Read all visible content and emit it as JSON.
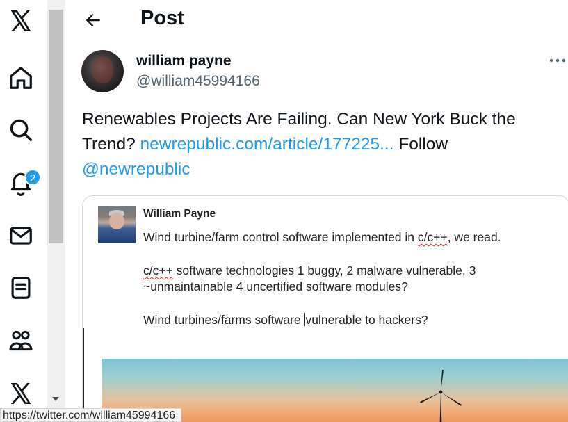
{
  "nav": {
    "items": [
      {
        "name": "x-logo-icon"
      },
      {
        "name": "home-icon"
      },
      {
        "name": "search-icon"
      },
      {
        "name": "notifications-icon",
        "badge": "2"
      },
      {
        "name": "messages-icon"
      },
      {
        "name": "lists-icon"
      },
      {
        "name": "communities-icon"
      },
      {
        "name": "premium-x-icon"
      }
    ],
    "accent": "#1d9bf0"
  },
  "header": {
    "title": "Post"
  },
  "post": {
    "author_name": "william payne",
    "author_handle": "@william45994166",
    "text_before": "Renewables Projects Are Failing. Can New York Buck the Trend? ",
    "link_text": "newrepublic.com/article/177225...",
    "text_middle": " Follow",
    "mention": "@newrepublic"
  },
  "card": {
    "name": "William Payne",
    "line1_before": "Wind turbine/farm control software implemented in ",
    "line1_marked": "c/c++",
    "line1_after": ", we read.",
    "line2_marked": "c/c++",
    "line2_after": " software technologies 1 buggy, 2 malware vulnerable, 3",
    "line3": "~unmaintainable 4 uncertified software modules?",
    "line4_before": "Wind turbines/farms software ",
    "line4_after": "vulnerable to hackers?"
  },
  "status_bar": {
    "url": "https://twitter.com/william45994166"
  }
}
